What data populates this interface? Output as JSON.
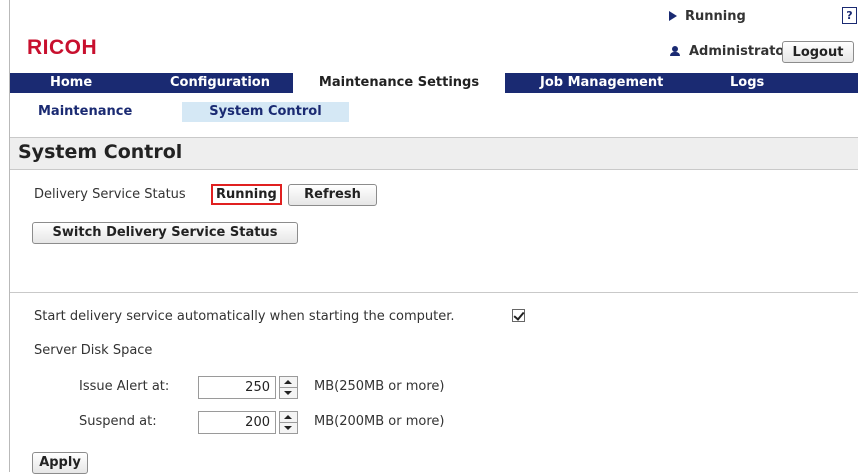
{
  "brand": {
    "logo_text": "RICOH",
    "logo_color": "#c8102e"
  },
  "header": {
    "status_text": "Running",
    "help_label": "?",
    "user_name": "Administrator",
    "logout_label": "Logout"
  },
  "nav": {
    "tabs": [
      {
        "label": "Home"
      },
      {
        "label": "Configuration"
      },
      {
        "label": "Maintenance Settings"
      },
      {
        "label": "Job Management"
      },
      {
        "label": "Logs"
      }
    ],
    "active": "Maintenance Settings",
    "bar_color": "#1a2a72"
  },
  "subnav": {
    "items": [
      {
        "label": "Maintenance"
      },
      {
        "label": "System Control"
      }
    ],
    "active": "System Control"
  },
  "page": {
    "title": "System Control"
  },
  "delivery": {
    "label": "Delivery Service Status",
    "status": "Running",
    "refresh_label": "Refresh",
    "switch_label": "Switch Delivery Service Status"
  },
  "settings": {
    "auto_start_label": "Start delivery service automatically when starting the computer.",
    "auto_start_checked": true,
    "disk_space_label": "Server Disk Space",
    "alert": {
      "label": "Issue Alert at:",
      "value": "250",
      "unit": "MB(250MB or more)"
    },
    "suspend": {
      "label": "Suspend at:",
      "value": "200",
      "unit": "MB(200MB or more)"
    },
    "apply_label": "Apply"
  }
}
